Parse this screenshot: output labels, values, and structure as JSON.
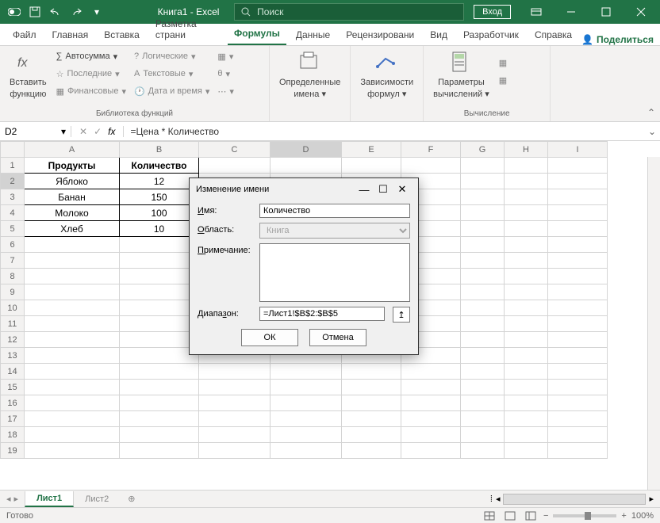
{
  "titlebar": {
    "title": "Книга1 - Excel",
    "search_placeholder": "Поиск",
    "login": "Вход"
  },
  "tabs": {
    "file": "Файл",
    "home": "Главная",
    "insert": "Вставка",
    "layout": "Разметка страни",
    "formulas": "Формулы",
    "data": "Данные",
    "review": "Рецензировани",
    "view": "Вид",
    "developer": "Разработчик",
    "help": "Справка",
    "share": "Поделиться"
  },
  "ribbon": {
    "insert_fn_l1": "Вставить",
    "insert_fn_l2": "функцию",
    "autosum": "Автосумма",
    "recent": "Последние",
    "financial": "Финансовые",
    "logical": "Логические",
    "text": "Текстовые",
    "datetime": "Дата и время",
    "lib_label": "Библиотека функций",
    "defined_names_l1": "Определенные",
    "defined_names_l2": "имена",
    "formula_audit_l1": "Зависимости",
    "formula_audit_l2": "формул",
    "calc_opts_l1": "Параметры",
    "calc_opts_l2": "вычислений",
    "calc_label": "Вычисление"
  },
  "fbar": {
    "cell": "D2",
    "formula": "=Цена * Количество"
  },
  "grid": {
    "cols": [
      "A",
      "B",
      "C",
      "D",
      "E",
      "F",
      "G",
      "H",
      "I"
    ],
    "headers": {
      "A": "Продукты",
      "B": "Количество"
    },
    "rows": [
      {
        "A": "Яблоко",
        "B": "12"
      },
      {
        "A": "Банан",
        "B": "150"
      },
      {
        "A": "Молоко",
        "B": "100"
      },
      {
        "A": "Хлеб",
        "B": "10"
      }
    ]
  },
  "sheets": {
    "s1": "Лист1",
    "s2": "Лист2"
  },
  "status": {
    "ready": "Готово",
    "zoom": "100%"
  },
  "dialog": {
    "title": "Изменение имени",
    "name_label": "Имя:",
    "name_value": "Количество",
    "scope_label": "Область:",
    "scope_value": "Книга",
    "comment_label": "Примечание:",
    "range_label": "Диапазон:",
    "range_value": "=Лист1!$B$2:$B$5",
    "ok": "ОК",
    "cancel": "Отмена"
  }
}
